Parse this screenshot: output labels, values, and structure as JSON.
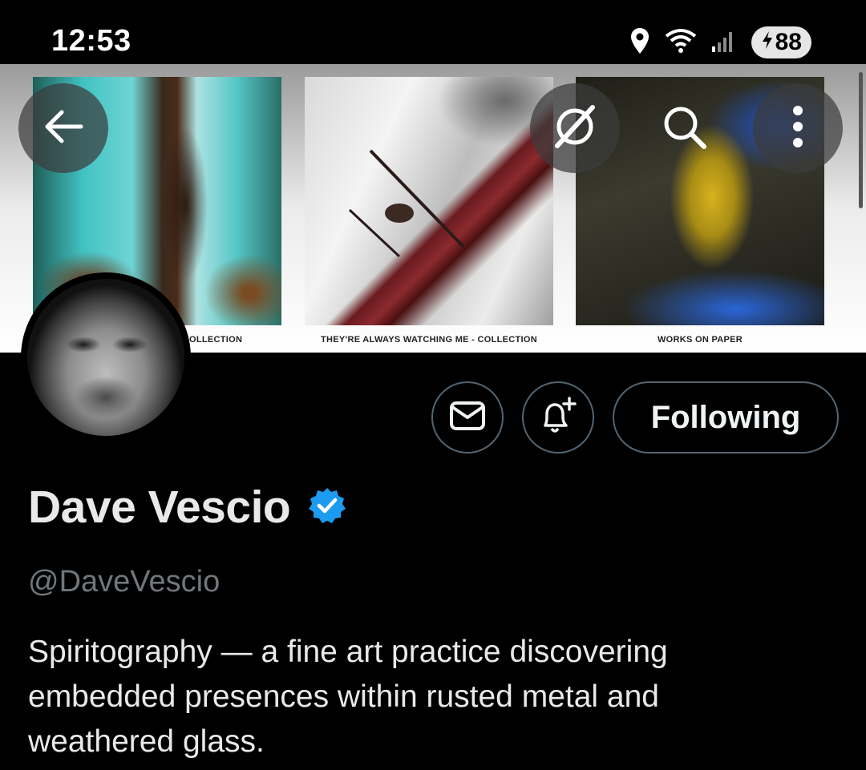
{
  "status_bar": {
    "time": "12:53",
    "battery_level": "88",
    "icons": [
      "location-icon",
      "wifi-icon",
      "signal-icon",
      "battery-charging-icon"
    ]
  },
  "banner": {
    "captions": [
      "OLLECTION",
      "THEY'RE ALWAYS WATCHING ME - COLLECTION",
      "WORKS ON PAPER"
    ]
  },
  "header_actions": {
    "icons": [
      "back-arrow-icon",
      "grok-icon",
      "search-icon",
      "more-vertical-icon"
    ]
  },
  "actions": {
    "icons": [
      "mail-icon",
      "bell-plus-icon"
    ],
    "following_label": "Following"
  },
  "profile": {
    "name": "Dave Vescio",
    "handle": "@DaveVescio",
    "bio": "Spiritography — a fine art practice discovering embedded presences within rusted metal and weathered glass.",
    "verified_color": "#1d9bf0"
  }
}
